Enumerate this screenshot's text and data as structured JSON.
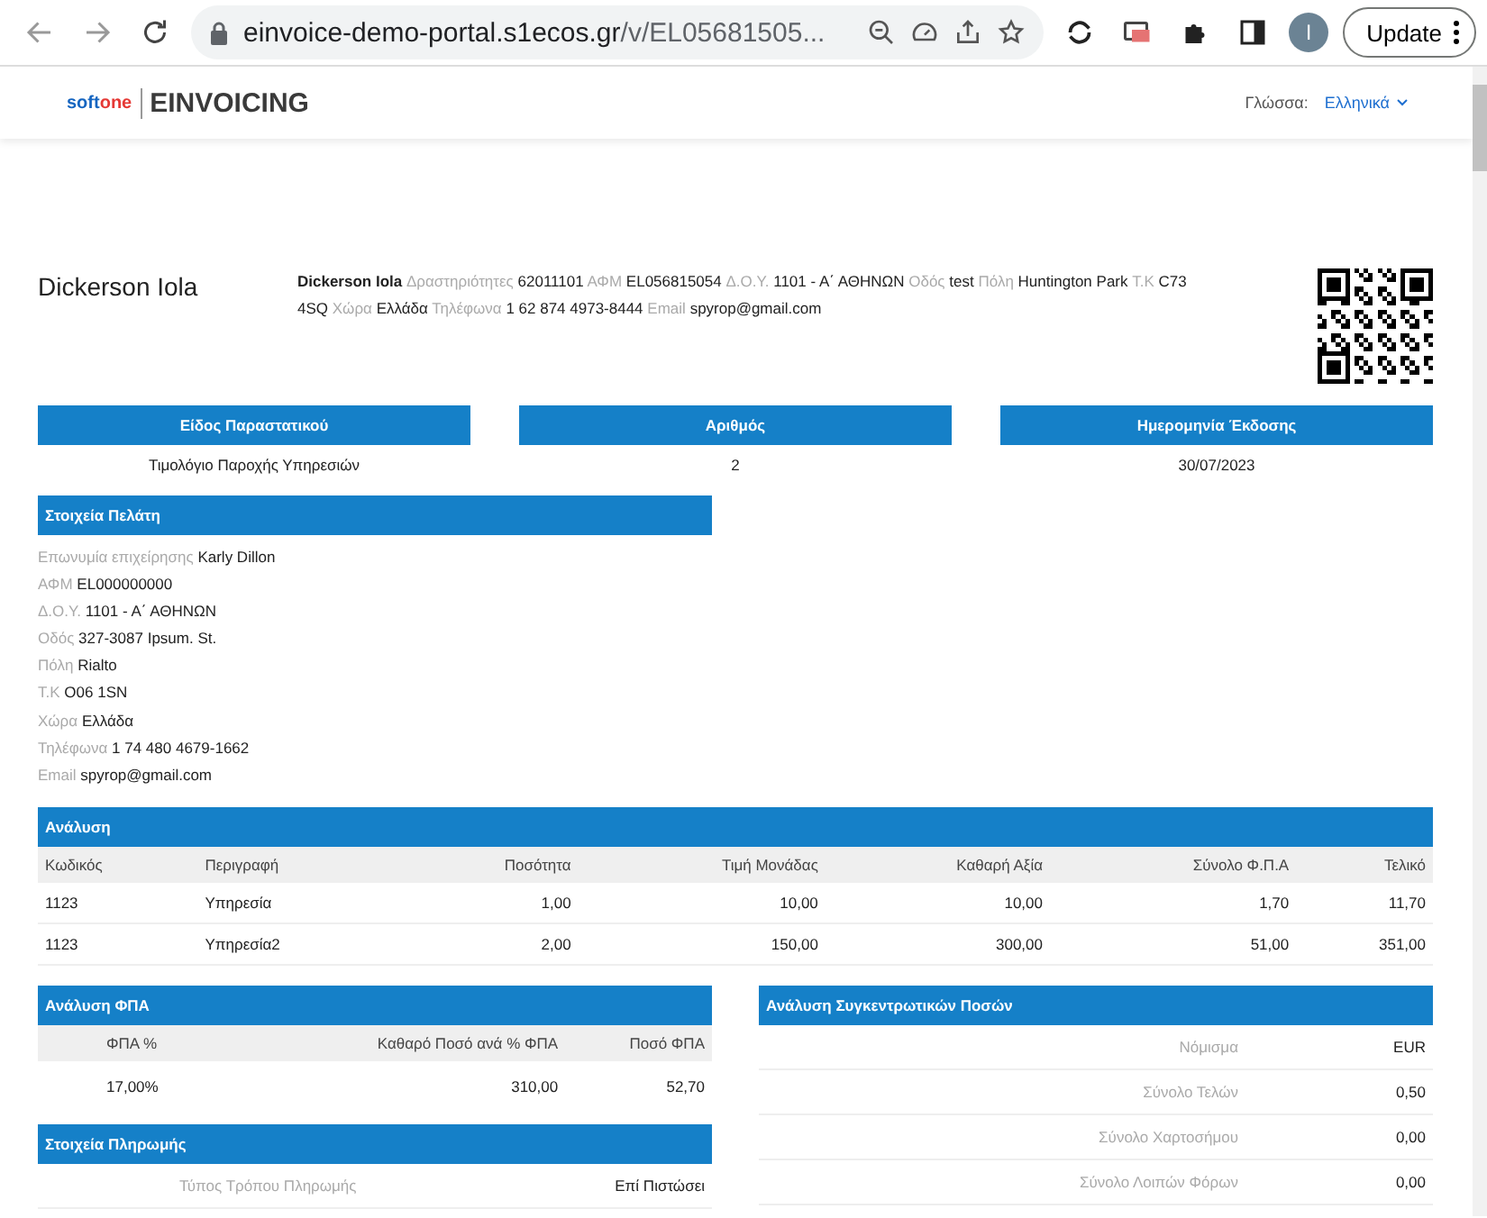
{
  "browser": {
    "url_host": "einvoice-demo-portal.s1ecos.gr",
    "url_path": "/v/EL05681505...",
    "avatar": "I",
    "update_button": "Update"
  },
  "header": {
    "logo_left": "soft",
    "logo_left_accent": "one",
    "logo_right": "EINVOICING",
    "language_label": "Γλώσσα:",
    "language_value": "Ελληνικά"
  },
  "issuer": {
    "title": "Dickerson Iola",
    "name": "Dickerson Iola",
    "fields": [
      {
        "label": "Δραστηριότητες",
        "value": "62011101"
      },
      {
        "label": "ΑΦΜ",
        "value": "EL056815054"
      },
      {
        "label": "Δ.Ο.Υ.",
        "value": "1101 - Α΄ ΑΘΗΝΩΝ"
      },
      {
        "label": "Οδός",
        "value": "test"
      },
      {
        "label": "Πόλη",
        "value": "Huntington Park"
      },
      {
        "label": "Τ.Κ",
        "value": "C73 4SQ"
      },
      {
        "label": "Χώρα",
        "value": "Ελλάδα"
      },
      {
        "label": "Τηλέφωνα",
        "value": "1 62 874 4973-8444"
      },
      {
        "label": "Email",
        "value": "spyrop@gmail.com"
      }
    ]
  },
  "document_info": [
    {
      "heading": "Είδος Παραστατικού",
      "value": "Τιμολόγιο Παροχής Υπηρεσιών"
    },
    {
      "heading": "Αριθμός",
      "value": "2"
    },
    {
      "heading": "Ημερομηνία Έκδοσης",
      "value": "30/07/2023"
    }
  ],
  "customer": {
    "heading": "Στοιχεία Πελάτη",
    "fields": [
      {
        "label": "Επωνυμία επιχείρησης",
        "value": "Karly Dillon"
      },
      {
        "label": "ΑΦΜ",
        "value": "EL000000000"
      },
      {
        "label": "Δ.Ο.Υ.",
        "value": "1101 - Α΄ ΑΘΗΝΩΝ"
      },
      {
        "label": "Οδός",
        "value": "327-3087 Ipsum. St."
      },
      {
        "label": "Πόλη",
        "value": "Rialto"
      },
      {
        "label": "Τ.Κ",
        "value": "O06 1SN"
      },
      {
        "label": "Χώρα",
        "value": "Ελλάδα"
      },
      {
        "label": "Τηλέφωνα",
        "value": "1 74 480 4679-1662"
      },
      {
        "label": "Email",
        "value": "spyrop@gmail.com"
      }
    ]
  },
  "analysis": {
    "heading": "Ανάλυση",
    "columns": [
      "Κωδικός",
      "Περιγραφή",
      "Ποσότητα",
      "Τιμή Μονάδας",
      "Καθαρή Αξία",
      "Σύνολο Φ.Π.Α",
      "Τελικό"
    ],
    "rows": [
      [
        "1123",
        "Υπηρεσία",
        "1,00",
        "10,00",
        "10,00",
        "1,70",
        "11,70"
      ],
      [
        "1123",
        "Υπηρεσία2",
        "2,00",
        "150,00",
        "300,00",
        "51,00",
        "351,00"
      ]
    ]
  },
  "vat": {
    "heading": "Ανάλυση ΦΠΑ",
    "columns": [
      "ΦΠΑ %",
      "Καθαρό Ποσό ανά % ΦΠΑ",
      "Ποσό ΦΠΑ"
    ],
    "rows": [
      [
        "17,00%",
        "310,00",
        "52,70"
      ]
    ]
  },
  "payment": {
    "heading": "Στοιχεία Πληρωμής",
    "rows": [
      {
        "label": "Τύπος Τρόπου Πληρωμής",
        "value": "Επί Πιστώσει"
      }
    ]
  },
  "totals": {
    "heading": "Ανάλυση Συγκεντρωτικών Ποσών",
    "rows": [
      {
        "label": "Νόμισμα",
        "value": "EUR"
      },
      {
        "label": "Σύνολο Τελών",
        "value": "0,50"
      },
      {
        "label": "Σύνολο Χαρτοσήμου",
        "value": "0,00"
      },
      {
        "label": "Σύνολο Λοιπών Φόρων",
        "value": "0,00"
      }
    ]
  }
}
